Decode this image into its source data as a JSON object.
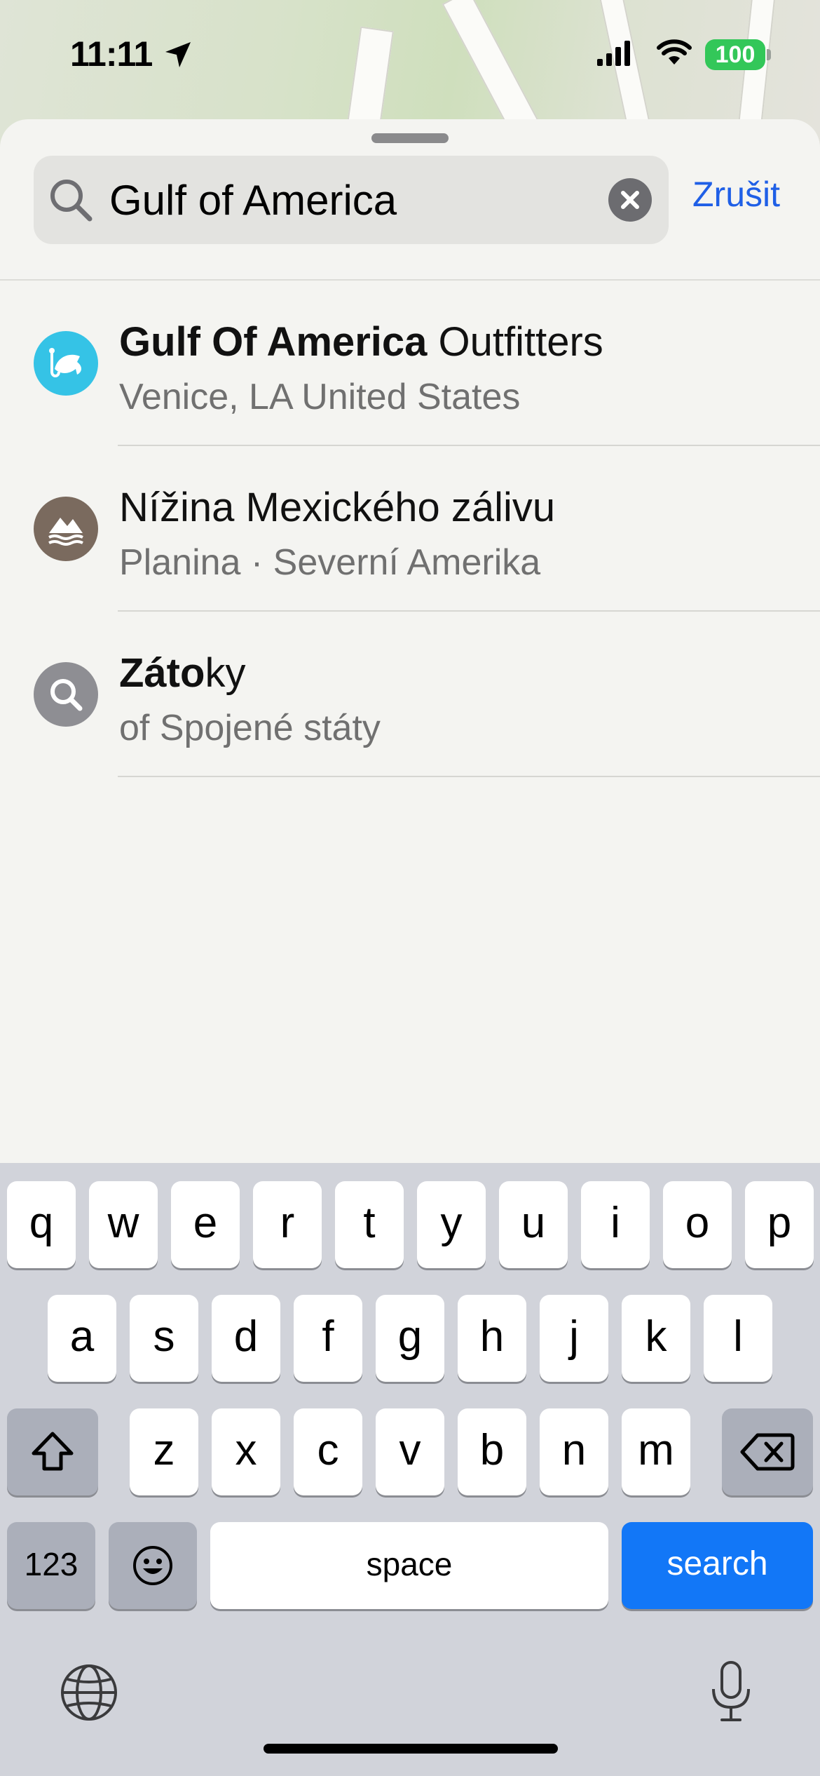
{
  "status_bar": {
    "time": "11:11",
    "battery": "100"
  },
  "search": {
    "query": "Gulf of America",
    "cancel_label": "Zrušit"
  },
  "results": [
    {
      "title_bold": "Gulf Of America",
      "title_rest": " Outfitters",
      "subtitle": "Venice, LA United States",
      "icon": "fishing-icon",
      "icon_color": "#35c3e6"
    },
    {
      "title_bold": "",
      "title_rest": "Nížina Mexického zálivu",
      "subtitle": "Planina · Severní Amerika",
      "icon": "landscape-icon",
      "icon_color": "#7a6a5e"
    },
    {
      "title_bold": "Záto",
      "title_rest": "ky",
      "subtitle": "of Spojené státy",
      "icon": "search-icon",
      "icon_color": "#8e8e93"
    }
  ],
  "keyboard": {
    "row1": [
      "q",
      "w",
      "e",
      "r",
      "t",
      "y",
      "u",
      "i",
      "o",
      "p"
    ],
    "row2": [
      "a",
      "s",
      "d",
      "f",
      "g",
      "h",
      "j",
      "k",
      "l"
    ],
    "row3": [
      "z",
      "x",
      "c",
      "v",
      "b",
      "n",
      "m"
    ],
    "numbers_label": "123",
    "space_label": "space",
    "search_label": "search"
  },
  "colors": {
    "accent": "#1f5fe6",
    "keyboard_action": "#1277f7",
    "battery": "#33c759"
  }
}
